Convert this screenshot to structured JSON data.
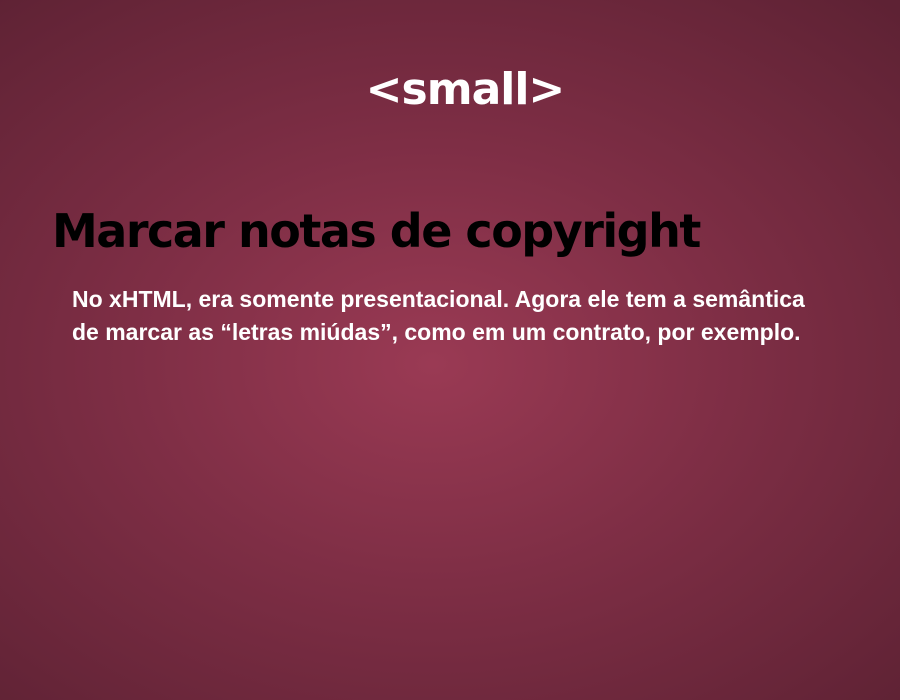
{
  "slide": {
    "tag": "<small>",
    "heading": "Marcar notas de copyright",
    "body": "No xHTML, era somente presentacional. Agora ele tem a semântica de marcar as “letras miúdas”, como em um contrato, por exemplo."
  },
  "colors": {
    "background_center": "#9a3a54",
    "background_edge": "#5e2234",
    "tag_text": "#ffffff",
    "heading_text": "#000000",
    "body_text": "#ffffff"
  }
}
